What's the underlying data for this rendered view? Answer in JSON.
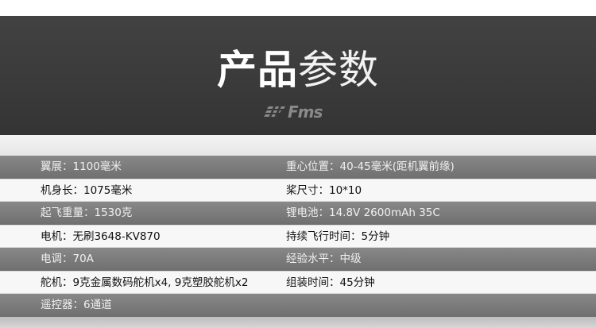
{
  "header": {
    "title_bold": "产品",
    "title_light": "参数",
    "logo_text": "Fms"
  },
  "specs": [
    {
      "left": "翼展：1100毫米",
      "right": "重心位置：40-45毫米(距机翼前缘)"
    },
    {
      "left": "机身长：1075毫米",
      "right": "桨尺寸：10*10"
    },
    {
      "left": "起飞重量：1530克",
      "right": "锂电池：14.8V 2600mAh 35C"
    },
    {
      "left": "电机：无刷3648-KV870",
      "right": "持续飞行时间：5分钟"
    },
    {
      "left": "电调：70A",
      "right": "经验水平：中级"
    },
    {
      "left": "舵机：9克金属数码舵机x4, 9克塑胶舵机x2",
      "right": "组装时间：45分钟"
    },
    {
      "left": "遥控器：6通道",
      "right": ""
    }
  ]
}
